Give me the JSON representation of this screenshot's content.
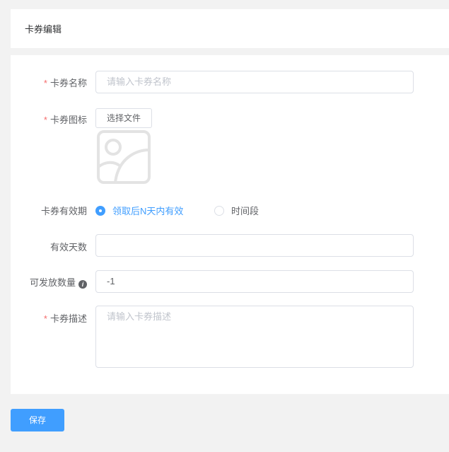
{
  "header": {
    "title": "卡券编辑"
  },
  "form": {
    "name": {
      "label": "卡券名称",
      "placeholder": "请输入卡券名称"
    },
    "icon": {
      "label": "卡券图标",
      "button": "选择文件"
    },
    "validity": {
      "label": "卡券有效期",
      "options": [
        "领取后N天内有效",
        "时间段"
      ],
      "selected": 0
    },
    "days": {
      "label": "有效天数",
      "value": ""
    },
    "quantity": {
      "label": "可发放数量",
      "value": "-1"
    },
    "desc": {
      "label": "卡券描述",
      "placeholder": "请输入卡券描述"
    },
    "required_mark": "*"
  },
  "save_label": "保存",
  "colors": {
    "accent": "#409eff",
    "required": "#f56c6c"
  }
}
